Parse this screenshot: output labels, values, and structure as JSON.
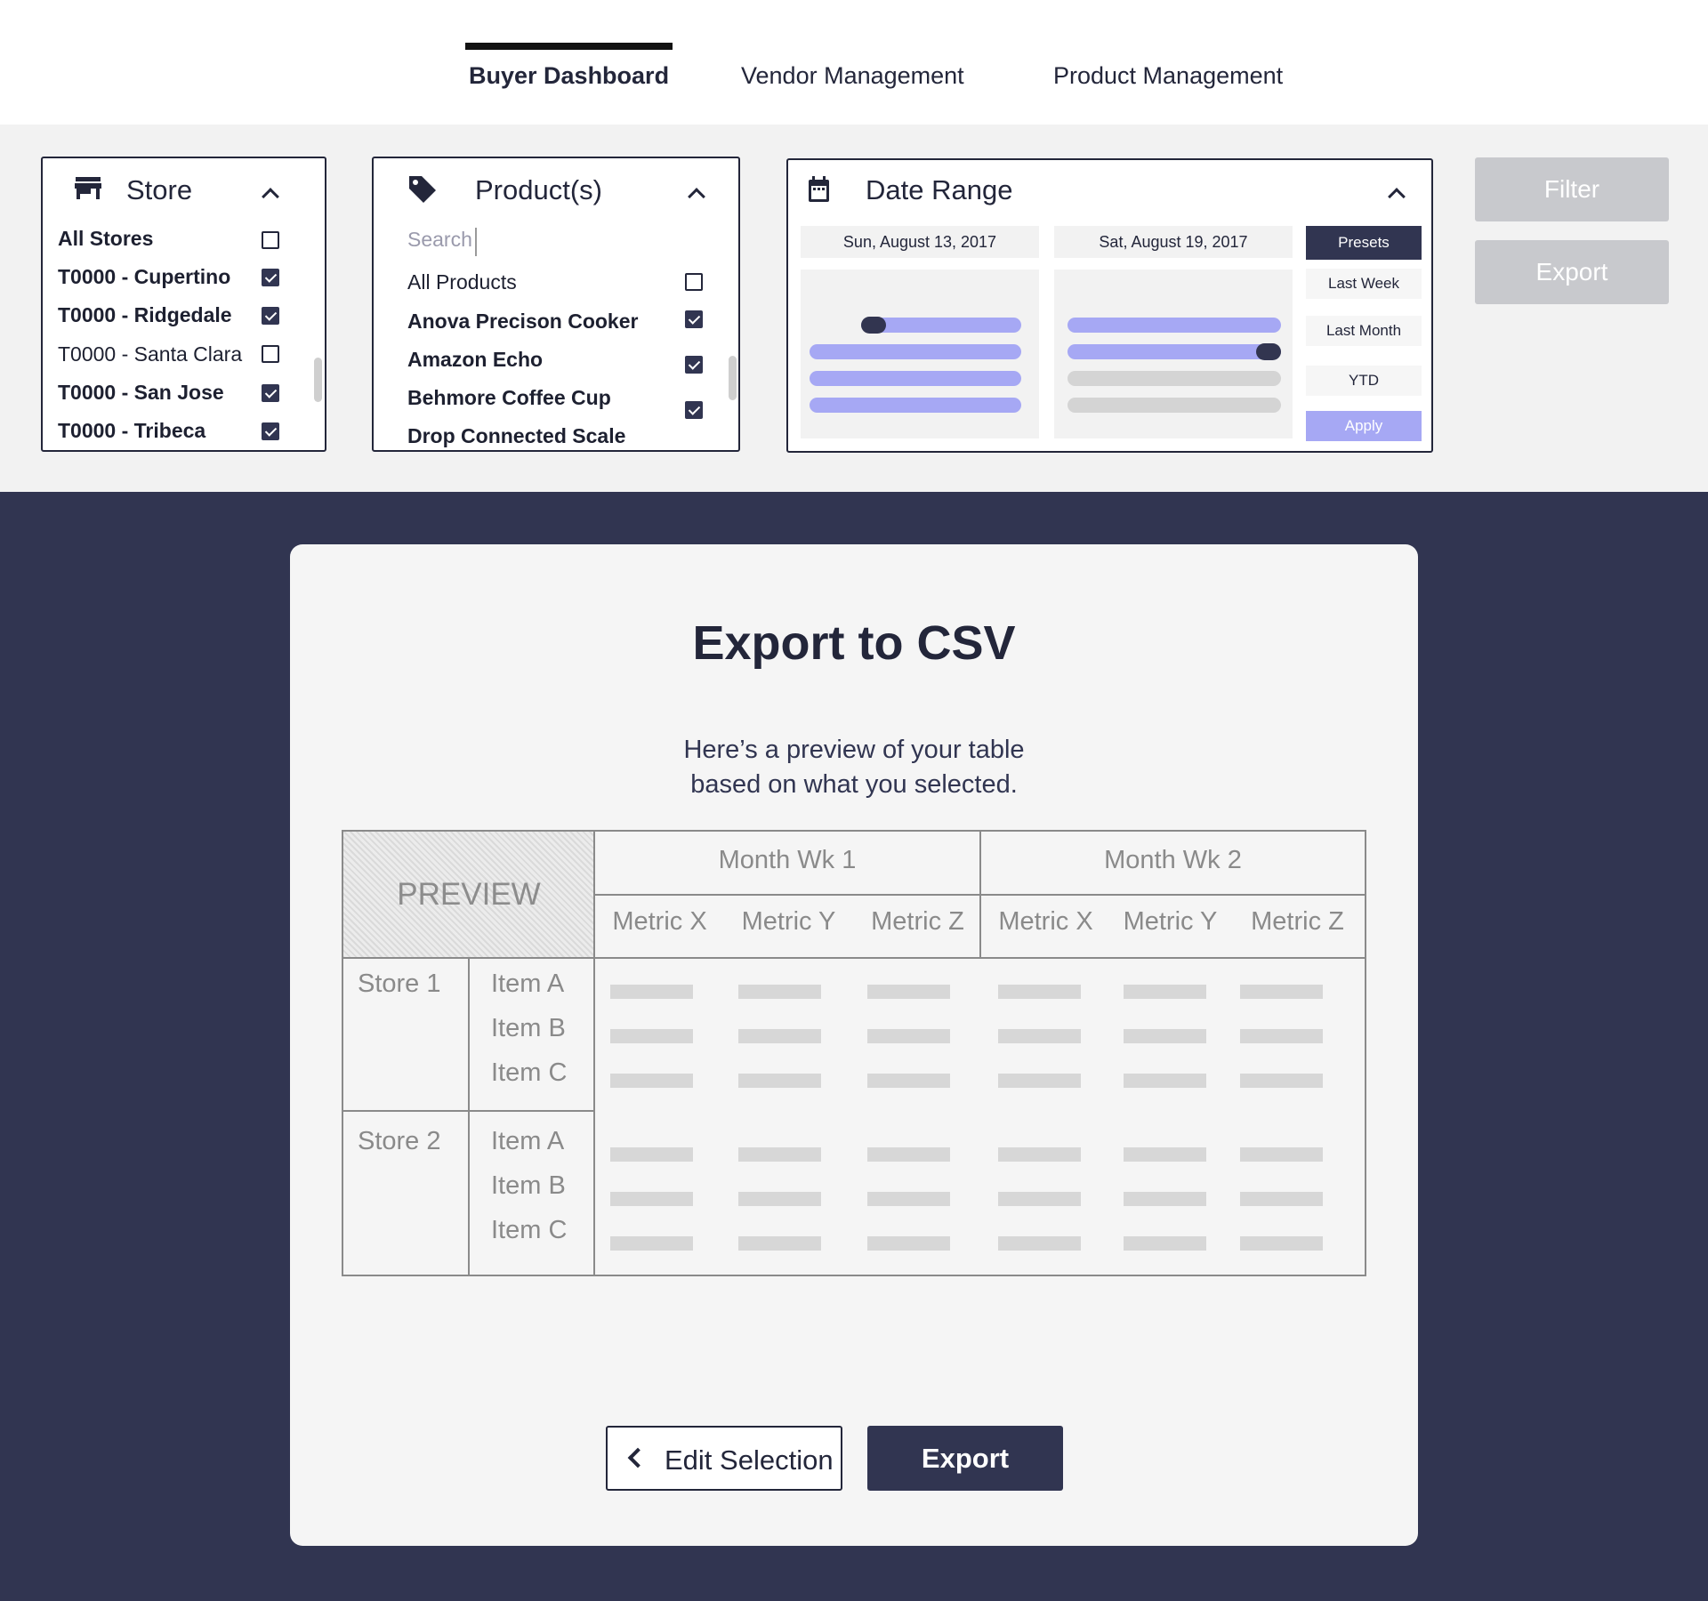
{
  "nav": {
    "tabs": [
      {
        "label": "Buyer Dashboard",
        "active": true
      },
      {
        "label": "Vendor Management",
        "active": false
      },
      {
        "label": "Product Management",
        "active": false
      }
    ]
  },
  "filters": {
    "store": {
      "title": "Store",
      "icon": "store-icon",
      "options": [
        {
          "label": "All Stores",
          "checked": false
        },
        {
          "label": "T0000 - Cupertino",
          "checked": true
        },
        {
          "label": "T0000 - Ridgedale",
          "checked": true
        },
        {
          "label": "T0000 - Santa Clara",
          "checked": false
        },
        {
          "label": "T0000 - San Jose",
          "checked": true
        },
        {
          "label": "T0000 - Tribeca",
          "checked": true
        }
      ]
    },
    "products": {
      "title": "Product(s)",
      "icon": "tag-icon",
      "search_placeholder": "Search",
      "options": [
        {
          "label": "All Products",
          "checked": false
        },
        {
          "label": "Anova Precison Cooker",
          "checked": true
        },
        {
          "label": "Amazon Echo",
          "checked": true
        },
        {
          "label": "Behmore Coffee Cup",
          "checked": true
        },
        {
          "label": "Drop Connected Scale",
          "checked": false
        }
      ]
    },
    "date_range": {
      "title": "Date Range",
      "icon": "calendar-icon",
      "start_date": "Sun, August 13, 2017",
      "end_date": "Sat, August 19, 2017",
      "presets_label": "Presets",
      "presets": [
        "Last Week",
        "Last Month",
        "YTD"
      ],
      "apply_label": "Apply"
    },
    "filter_label": "Filter",
    "export_label": "Export"
  },
  "modal": {
    "title": "Export to CSV",
    "subtitle_line1": "Here’s a preview of your table",
    "subtitle_line2": "based on what you selected.",
    "preview_label": "PREVIEW",
    "weeks": [
      "Month Wk 1",
      "Month Wk 2"
    ],
    "metrics": [
      "Metric X",
      "Metric Y",
      "Metric Z",
      "Metric X",
      "Metric Y",
      "Metric Z"
    ],
    "stores": [
      {
        "name": "Store 1",
        "items": [
          "Item A",
          "Item B",
          "Item C"
        ]
      },
      {
        "name": "Store 2",
        "items": [
          "Item A",
          "Item B",
          "Item C"
        ]
      }
    ],
    "edit_label": "Edit Selection",
    "export_label": "Export"
  }
}
